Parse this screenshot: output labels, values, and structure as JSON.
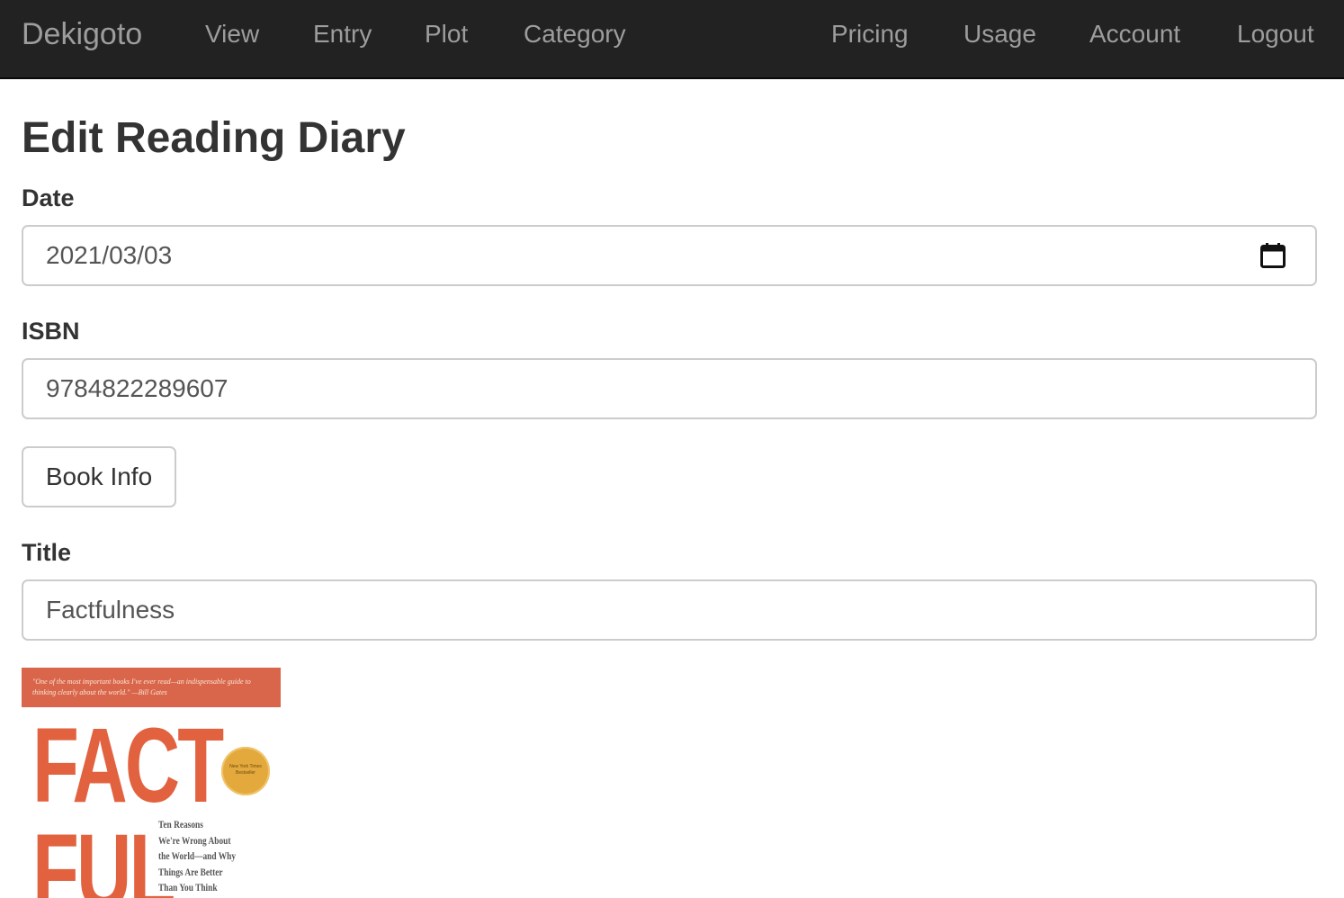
{
  "navbar": {
    "brand": "Dekigoto",
    "left_links": [
      "View",
      "Entry",
      "Plot",
      "Category"
    ],
    "right_links": [
      "Pricing",
      "Usage",
      "Account",
      "Logout"
    ]
  },
  "page": {
    "title": "Edit Reading Diary"
  },
  "form": {
    "date": {
      "label": "Date",
      "value": "2021/03/03"
    },
    "isbn": {
      "label": "ISBN",
      "value": "9784822289607"
    },
    "book_info_button": "Book Info",
    "title": {
      "label": "Title",
      "value": "Factfulness"
    }
  },
  "cover": {
    "quote": "\"One of the most important books I've ever read—an indispensable guide to thinking clearly about the world.\" —Bill Gates",
    "word_line1": "FACT",
    "word_line2": "FUL",
    "seal_text": "New York Times Bestseller",
    "subtitle": "Ten Reasons\nWe're Wrong About\nthe World—and Why\nThings Are Better\nThan You Think",
    "colors": {
      "band": "#d9664a",
      "title": "#e2623f",
      "seal": "#e4a93c"
    }
  },
  "colors": {
    "navbar_bg": "#222222",
    "nav_text": "#9d9d9d",
    "border": "#cccccc"
  }
}
